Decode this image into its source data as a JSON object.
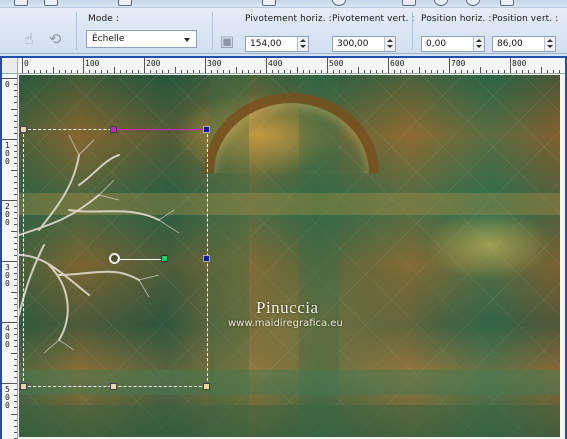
{
  "toolbar": {
    "mode_label": "Mode :",
    "mode_value": "Échelle",
    "pivot_h_label": "Pivotement horiz. :",
    "pivot_h_value": "154,00",
    "pivot_v_label": "Pivotement vert. :",
    "pivot_v_value": "300,00",
    "pos_h_label": "Position horiz. :",
    "pos_h_value": "0,00",
    "pos_v_label": "Position vert. :",
    "pos_v_value": "86,00"
  },
  "ruler": {
    "h_labels": [
      "0",
      "100",
      "200",
      "300",
      "400",
      "500",
      "600",
      "700",
      "800"
    ],
    "v_labels": [
      "0",
      "100",
      "200",
      "300",
      "400",
      "500"
    ]
  },
  "canvas": {
    "watermark_title": "Pinuccia",
    "watermark_url": "www.maidiregrafica.eu"
  },
  "colors": {
    "window_border": "#1f4fa8",
    "handle_magenta": "#d020c8",
    "handle_blue": "#1a1aa0",
    "handle_green": "#22c86a",
    "handle_tan": "#e8d8a0"
  }
}
